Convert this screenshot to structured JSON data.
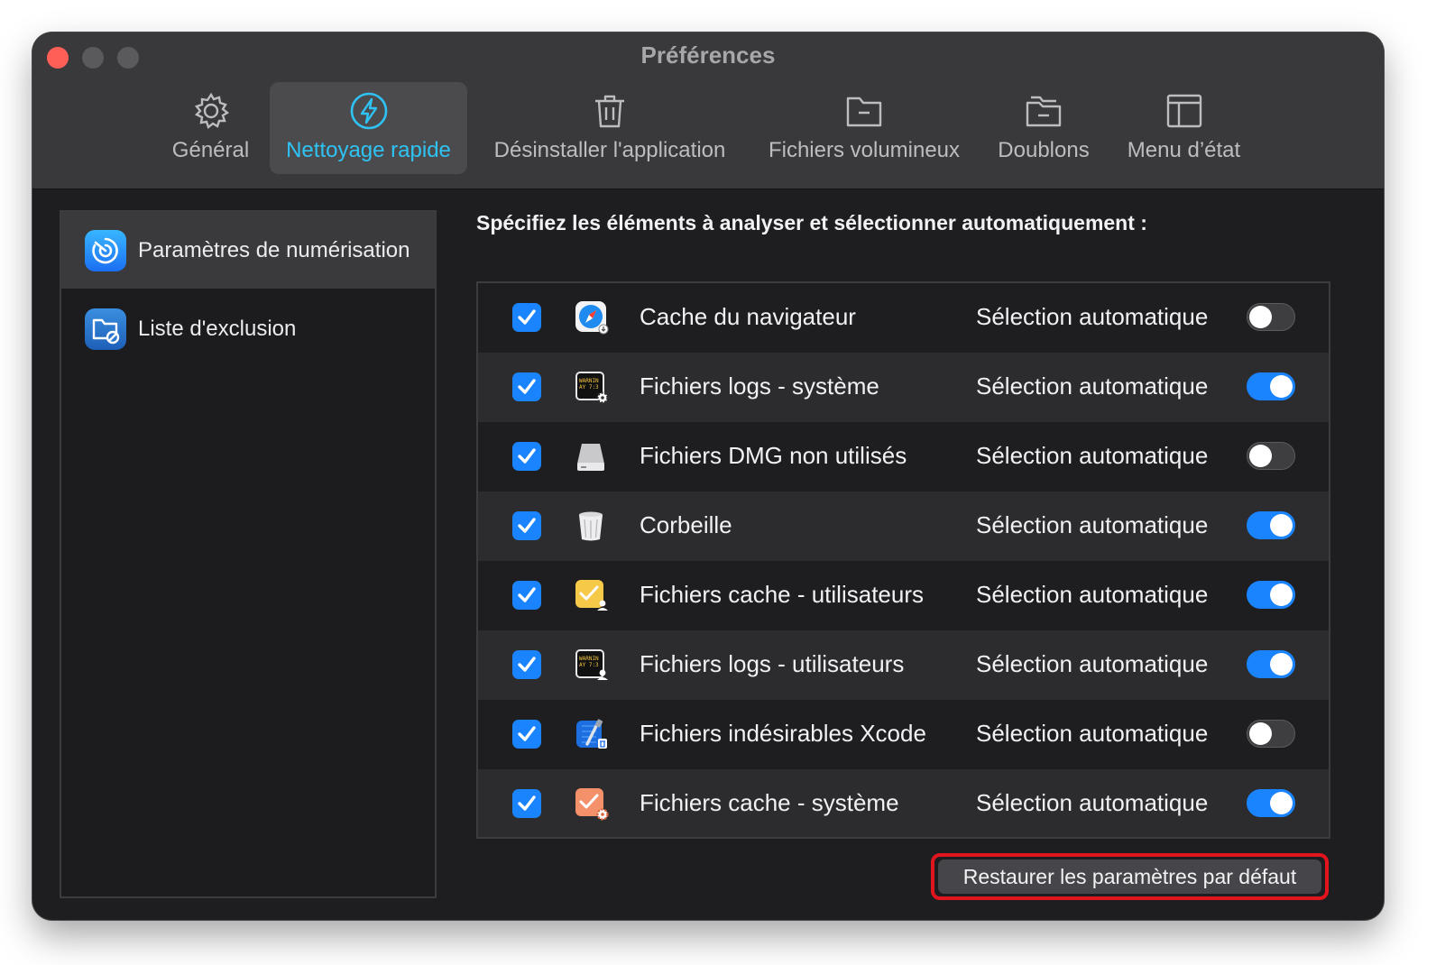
{
  "window": {
    "title": "Préférences"
  },
  "tabs": [
    {
      "label": "Général",
      "icon": "gear-icon"
    },
    {
      "label": "Nettoyage rapide",
      "icon": "lightning-icon",
      "active": true
    },
    {
      "label": "Désinstaller l'application",
      "icon": "trash-icon"
    },
    {
      "label": "Fichiers volumineux",
      "icon": "folder-icon"
    },
    {
      "label": "Doublons",
      "icon": "folders-icon"
    },
    {
      "label": "Menu d’état",
      "icon": "menu-layout-icon"
    }
  ],
  "sidebar": {
    "items": [
      {
        "label": "Paramètres de numérisation",
        "icon": "scan-radar-icon",
        "active": true
      },
      {
        "label": "Liste d'exclusion",
        "icon": "exclusion-folder-icon"
      }
    ]
  },
  "main": {
    "heading": "Spécifiez les éléments à analyser et sélectionner automatiquement :",
    "rows": [
      {
        "label": "Cache du navigateur",
        "icon": "safari-compass-icon",
        "checked": true,
        "auto_label": "Sélection automatique",
        "auto_on": false
      },
      {
        "label": "Fichiers logs - système",
        "icon": "system-log-icon",
        "checked": true,
        "auto_label": "Sélection automatique",
        "auto_on": true
      },
      {
        "label": "Fichiers DMG non utilisés",
        "icon": "disk-image-icon",
        "checked": true,
        "auto_label": "Sélection automatique",
        "auto_on": false
      },
      {
        "label": "Corbeille",
        "icon": "trash-bin-icon",
        "checked": true,
        "auto_label": "Sélection automatique",
        "auto_on": true
      },
      {
        "label": "Fichiers cache - utilisateurs",
        "icon": "user-cache-icon",
        "checked": true,
        "auto_label": "Sélection automatique",
        "auto_on": true
      },
      {
        "label": "Fichiers logs - utilisateurs",
        "icon": "user-log-icon",
        "checked": true,
        "auto_label": "Sélection automatique",
        "auto_on": true
      },
      {
        "label": "Fichiers indésirables Xcode",
        "icon": "xcode-icon",
        "checked": true,
        "auto_label": "Sélection automatique",
        "auto_on": false
      },
      {
        "label": "Fichiers cache - système",
        "icon": "system-cache-icon",
        "checked": true,
        "auto_label": "Sélection automatique",
        "auto_on": true
      }
    ]
  },
  "restore_button": {
    "label": "Restaurer les paramètres par défaut"
  },
  "colors": {
    "accent": "#1a84ff",
    "active_tab_text": "#2fc3f4",
    "highlight": "#e2141e"
  },
  "log_icon_text": {
    "warn": "WARNIN",
    "time": "AY 7:3"
  }
}
